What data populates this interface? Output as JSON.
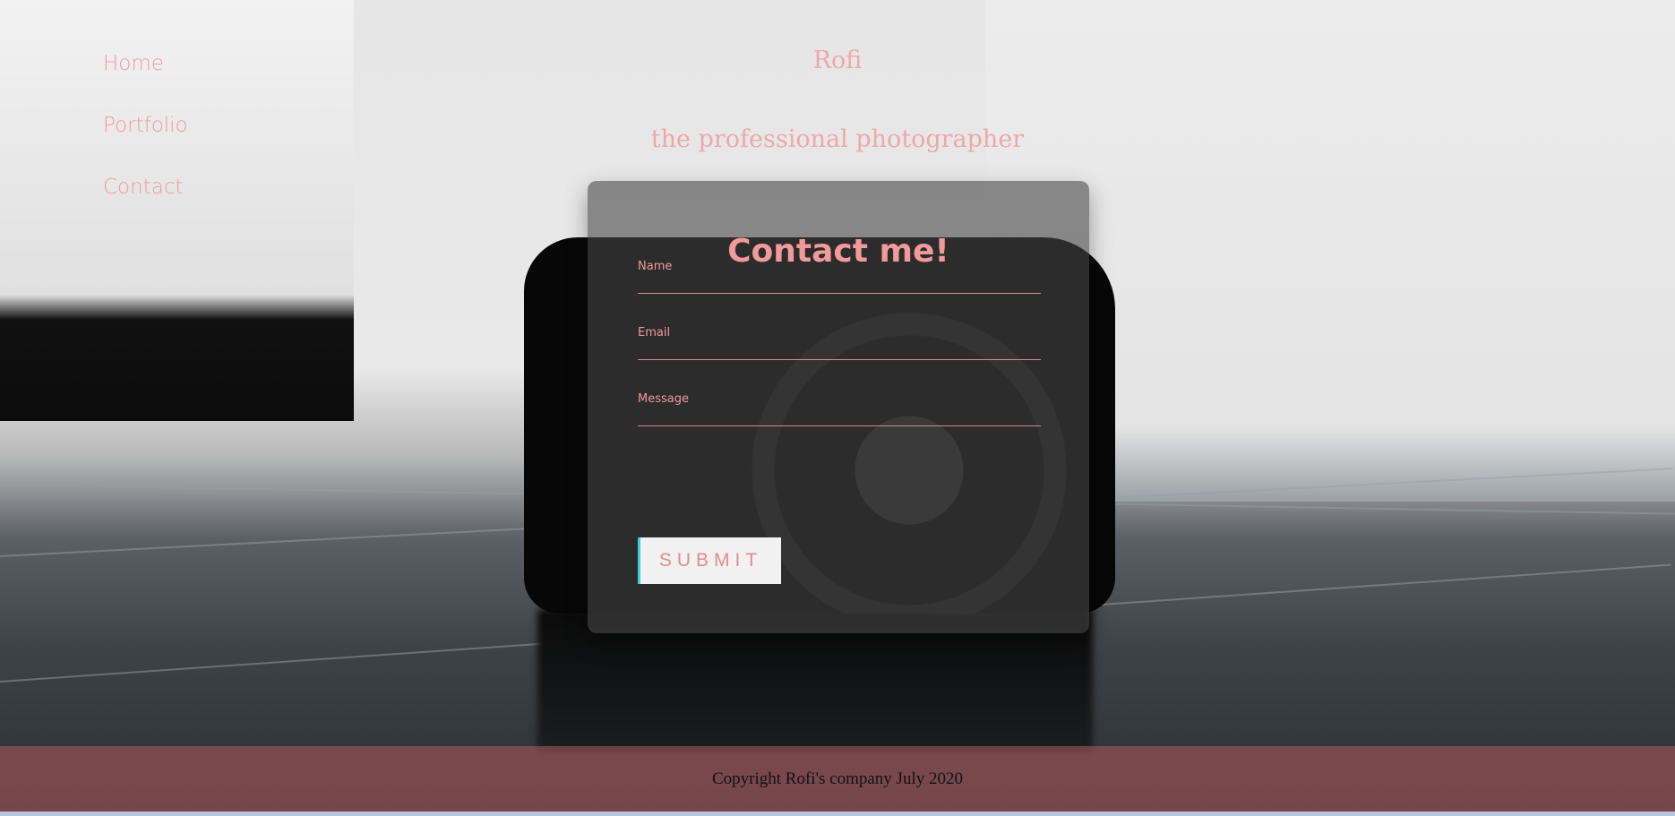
{
  "nav": {
    "items": [
      {
        "label": "Home"
      },
      {
        "label": "Portfolio"
      },
      {
        "label": "Contact"
      }
    ]
  },
  "header": {
    "title": "Rofi",
    "subtitle": "the professional photographer"
  },
  "contact": {
    "heading": "Contact me!",
    "fields": [
      {
        "label": "Name",
        "value": ""
      },
      {
        "label": "Email",
        "value": ""
      },
      {
        "label": "Message",
        "value": ""
      }
    ],
    "submit_label": "SUBMIT"
  },
  "footer": {
    "text": "Copyright Rofi's company July 2020"
  },
  "colors": {
    "accent": "#f29a9a",
    "footer": "#b45a5f"
  }
}
